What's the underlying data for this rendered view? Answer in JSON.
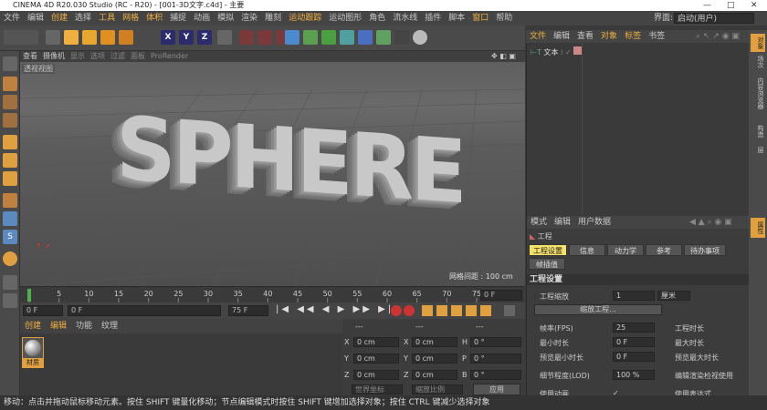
{
  "window": {
    "title": "CINEMA 4D R20.030 Studio (RC - R20) - [001-3D文字.c4d] - 主要"
  },
  "menu": {
    "items": [
      "文件",
      "编辑",
      "创建",
      "选择",
      "工具",
      "网格",
      "体积",
      "捕捉",
      "动画",
      "模拟",
      "渲染",
      "雕刻",
      "运动跟踪",
      "运动图形",
      "角色",
      "流水线",
      "插件",
      "脚本",
      "窗口",
      "帮助"
    ],
    "layout_label": "界面:",
    "layout_value": "启动(用户)"
  },
  "viewport": {
    "menu": [
      "查看",
      "摄像机",
      "显示",
      "选项",
      "过滤",
      "面板",
      "ProRender"
    ],
    "label": "透视视图",
    "text3d": "SPHERE",
    "grid_spacing": "网格间距 : 100 cm"
  },
  "timeline": {
    "ticks": [
      "0",
      "5",
      "10",
      "15",
      "20",
      "25",
      "30",
      "35",
      "40",
      "45",
      "50",
      "55",
      "60",
      "65",
      "70",
      "75"
    ],
    "current": "0 F",
    "start": "0 F",
    "end": "75 F",
    "end2": "75 F",
    "min": "0 F"
  },
  "material": {
    "menu": [
      "创建",
      "编辑",
      "功能",
      "纹理"
    ],
    "name": "材质"
  },
  "coords": {
    "rows": [
      {
        "a": "X",
        "av": "0 cm",
        "b": "X",
        "bv": "0 cm",
        "c": "H",
        "cv": "0 °"
      },
      {
        "a": "Y",
        "av": "0 cm",
        "b": "Y",
        "bv": "0 cm",
        "c": "P",
        "cv": "0 °"
      },
      {
        "a": "Z",
        "av": "0 cm",
        "b": "Z",
        "bv": "0 cm",
        "c": "B",
        "cv": "0 °"
      }
    ],
    "mode1": "世界坐标",
    "mode2": "缩放比例",
    "apply": "应用",
    "head1": "---",
    "head2": "---",
    "head3": "---"
  },
  "objects": {
    "menu": [
      "文件",
      "编辑",
      "查看",
      "对象",
      "标签",
      "书签"
    ],
    "items": [
      {
        "name": "文本"
      }
    ]
  },
  "attributes": {
    "menu": [
      "模式",
      "编辑",
      "用户数据"
    ],
    "header": "工程",
    "tabs": [
      "工程设置",
      "信息",
      "动力学",
      "参考",
      "待办事项",
      "帧插值"
    ],
    "section": "工程设置",
    "scale_label": "工程缩放",
    "scale_value": "1",
    "scale_unit": "厘米",
    "scale_button": "缩放工程...",
    "fields": [
      {
        "l": "帧率(FPS)",
        "v": "25",
        "r": "工程时长"
      },
      {
        "l": "最小时长",
        "v": "0 F",
        "r": "最大时长"
      },
      {
        "l": "预览最小时长",
        "v": "0 F",
        "r": "预览最大时长"
      },
      {
        "l": "细节程度(LOD)",
        "v": "100 %",
        "r": "编辑渲染检视使用"
      },
      {
        "l": "使用动画",
        "v": "✓",
        "r": "使用表达式"
      }
    ]
  },
  "rightstrip": {
    "tabs": [
      "对象",
      "场次",
      "内容浏览器",
      "构造",
      "层"
    ],
    "attr_tab": "属性"
  },
  "status": {
    "text": "移动：点击并拖动鼠标移动元素。按住 SHIFT 键量化移动；节点编辑模式时按住 SHIFT 键增加选择对象；按住 CTRL 键减少选择对象"
  },
  "colors": {
    "accent": "#f0b040",
    "selected_tab": "#f5e06a"
  }
}
